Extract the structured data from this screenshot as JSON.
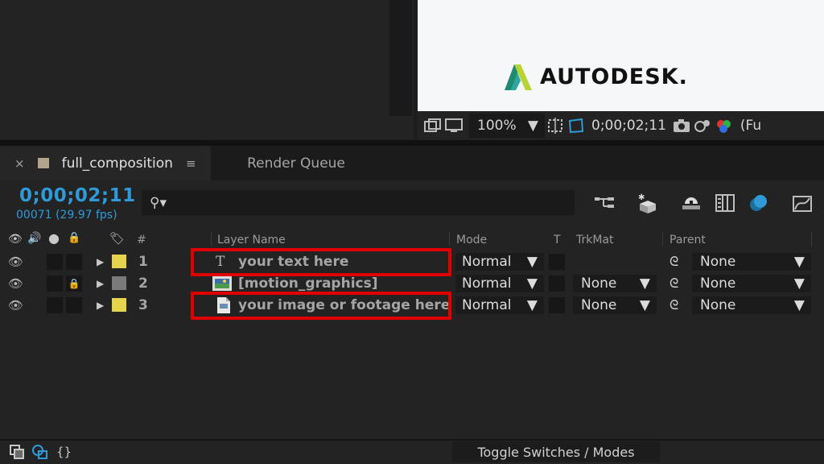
{
  "viewer": {
    "logo_text": "AUTODESK.",
    "zoom": "100%",
    "timecode": "0;00;02;11",
    "resolution_partial": "(Fu"
  },
  "tabs": [
    {
      "label": "full_composition",
      "close": "×",
      "menu": "≡"
    },
    {
      "label": "Render Queue"
    }
  ],
  "timeline": {
    "timecode": "0;00;02;11",
    "frames": "00071 (29.97 fps)",
    "search_placeholder": ""
  },
  "columns": {
    "hash": "#",
    "layer_name": "Layer Name",
    "mode": "Mode",
    "t": "T",
    "trkmat": "TrkMat",
    "parent": "Parent"
  },
  "layers": [
    {
      "num": "1",
      "name": "your text here",
      "mode": "Normal",
      "trkmat": "",
      "parent": "None",
      "locked": false,
      "label_color": "#e6d44e",
      "type_icon": "text-layer-icon"
    },
    {
      "num": "2",
      "name": "[motion_graphics]",
      "mode": "Normal",
      "trkmat": "None",
      "parent": "None",
      "locked": true,
      "label_color": "#7a7a7a",
      "type_icon": "composition-icon"
    },
    {
      "num": "3",
      "name": "your image or footage here",
      "mode": "Normal",
      "trkmat": "None",
      "parent": "None",
      "locked": false,
      "label_color": "#e6d44e",
      "type_icon": "image-file-icon"
    }
  ],
  "bottom": {
    "toggle_label": "Toggle Switches / Modes"
  },
  "colors": {
    "accent_blue": "#2f9ad6",
    "highlight_red": "#e00000",
    "comp_swatch": "#b1a48a"
  }
}
